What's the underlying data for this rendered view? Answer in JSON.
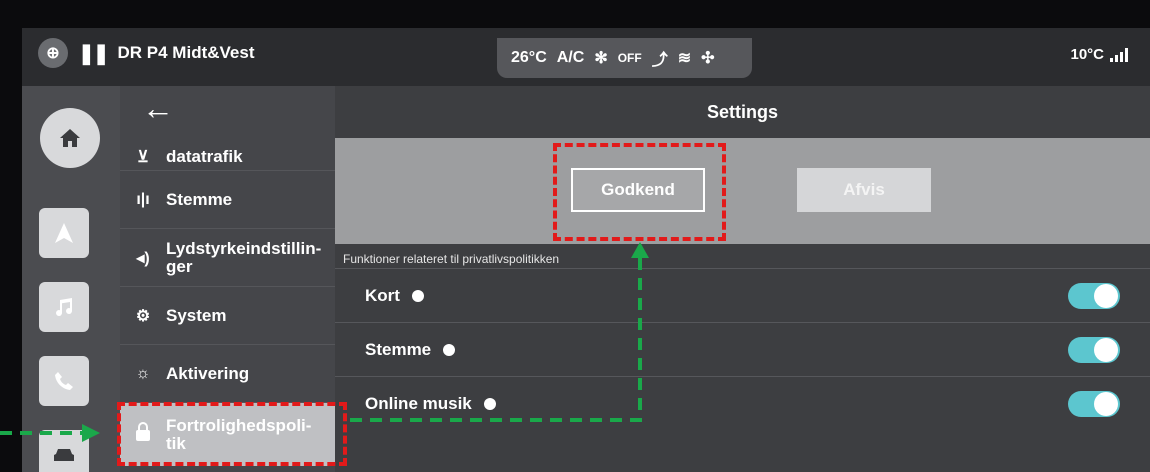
{
  "status_bar": {
    "station": "DR P4 Midt&Vest",
    "climate_temp": "26°C",
    "ac": "A/C",
    "fan": "OFF",
    "outside_temp": "10°C"
  },
  "header": {
    "title": "Settings",
    "back_icon": "arrow-left-icon"
  },
  "menu": {
    "items": [
      {
        "label": "datatrafik",
        "icon": "antenna-icon"
      },
      {
        "label": "Stemme",
        "icon": "voice-bars-icon"
      },
      {
        "label": "Lydstyrkeindstillin-ger",
        "icon": "speaker-icon"
      },
      {
        "label": "System",
        "icon": "gears-icon"
      },
      {
        "label": "Aktivering",
        "icon": "bulb-icon"
      },
      {
        "label": "Fortrolighedspoli-tik",
        "icon": "lock-icon",
        "selected": true
      }
    ]
  },
  "consent": {
    "accept_label": "Godkend",
    "decline_label": "Afvis"
  },
  "privacy": {
    "section_label": "Funktioner relateret til privatlivspolitikken",
    "rows": [
      {
        "label": "Kort",
        "enabled": true
      },
      {
        "label": "Stemme",
        "enabled": true
      },
      {
        "label": "Online musik",
        "enabled": true
      }
    ]
  },
  "colors": {
    "toggle_on": "#5cc6cf",
    "annotation_red": "#e21a1a",
    "annotation_green": "#1aa84a"
  }
}
